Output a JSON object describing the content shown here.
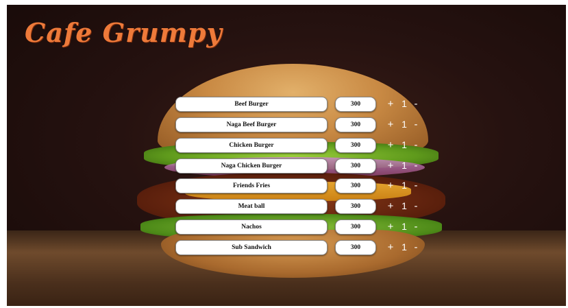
{
  "app": {
    "title": "Cafe Grumpy"
  },
  "colors": {
    "brand": "#ee7a3a",
    "pill_bg": "#ffffff",
    "control_text": "#ffffff"
  },
  "controls": {
    "plus": "+",
    "minus": "-"
  },
  "menu": {
    "items": [
      {
        "name": "Beef Burger",
        "price": "300",
        "qty": "1"
      },
      {
        "name": "Naga Beef Burger",
        "price": "300",
        "qty": "1"
      },
      {
        "name": "Chicken Burger",
        "price": "300",
        "qty": "1"
      },
      {
        "name": "Naga Chicken Burger",
        "price": "300",
        "qty": "1"
      },
      {
        "name": "Friends Fries",
        "price": "300",
        "qty": "1"
      },
      {
        "name": "Meat ball",
        "price": "300",
        "qty": "1"
      },
      {
        "name": "Nachos",
        "price": "300",
        "qty": "1"
      },
      {
        "name": "Sub Sandwich",
        "price": "300",
        "qty": "1"
      }
    ]
  }
}
